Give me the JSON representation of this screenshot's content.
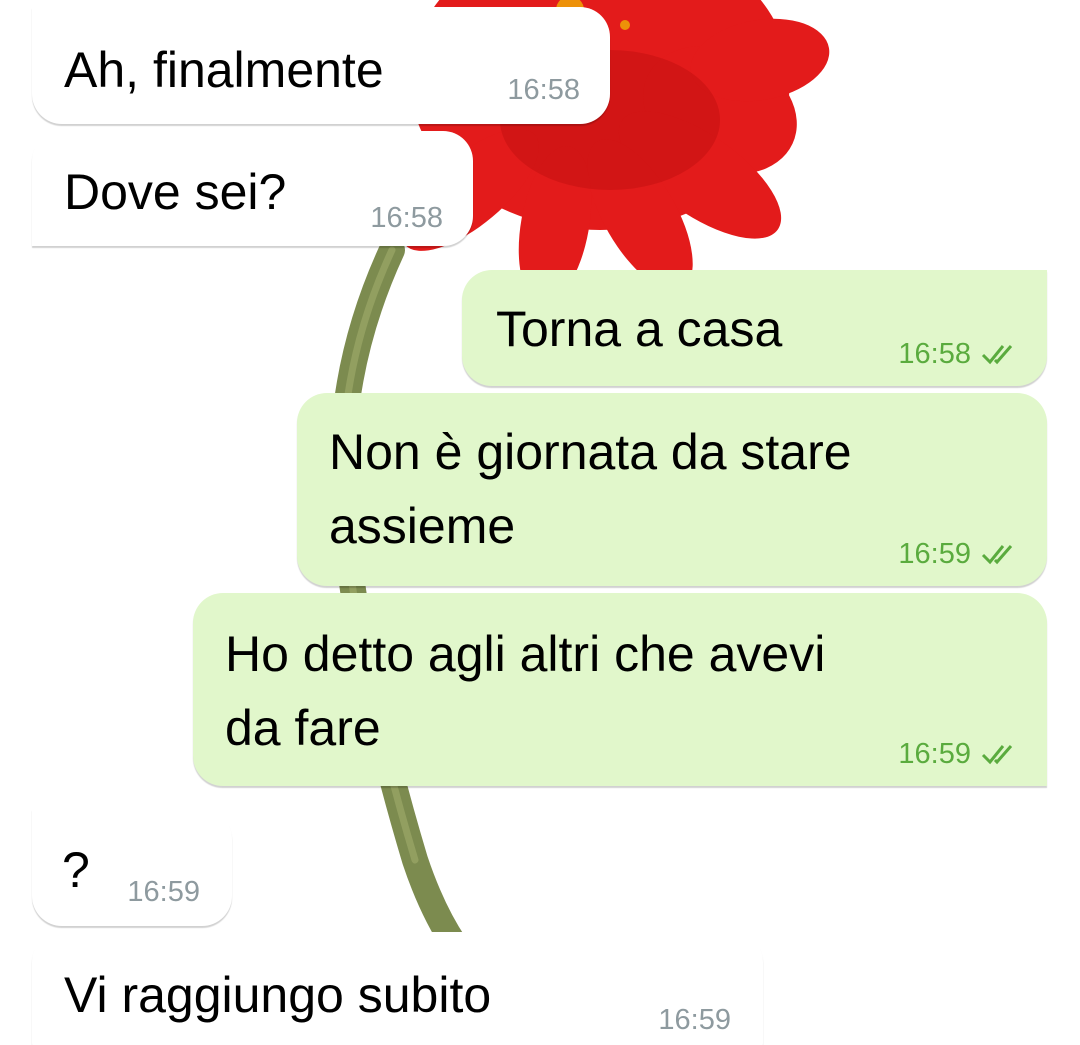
{
  "colors": {
    "incoming_bubble": "#ffffff",
    "outgoing_bubble": "#e1f7cb",
    "incoming_time": "#8e9a9f",
    "outgoing_time": "#5aab3e",
    "wallpaper_petal": "#e51c1c",
    "wallpaper_stem": "#7c8b4f"
  },
  "wallpaper": {
    "icon": "red-gerbera-flower"
  },
  "messages": [
    {
      "direction": "incoming",
      "text": "Ah, finalmente",
      "time": "16:58"
    },
    {
      "direction": "incoming",
      "text": "Dove sei?",
      "time": "16:58"
    },
    {
      "direction": "outgoing",
      "text": "Torna a casa",
      "time": "16:58",
      "status_icon": "double-check-icon"
    },
    {
      "direction": "outgoing",
      "line1": "Non è giornata da stare",
      "line2": "assieme",
      "time": "16:59",
      "status_icon": "double-check-icon"
    },
    {
      "direction": "outgoing",
      "line1": "Ho detto agli altri che avevi",
      "line2": "da fare",
      "time": "16:59",
      "status_icon": "double-check-icon"
    },
    {
      "direction": "incoming",
      "text": "?",
      "time": "16:59"
    },
    {
      "direction": "incoming",
      "text": "Vi raggiungo subito",
      "time": "16:59"
    }
  ]
}
